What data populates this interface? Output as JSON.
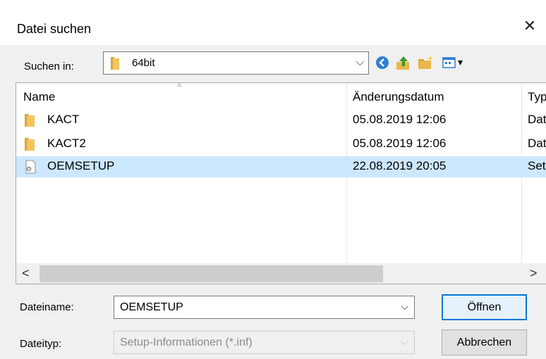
{
  "window": {
    "title": "Datei suchen",
    "close_glyph": "✕"
  },
  "lookin": {
    "label": "Suchen in:",
    "value": "64bit",
    "chevron": "⌵"
  },
  "toolbar": {
    "icons": [
      "back-icon",
      "up-folder-icon",
      "new-folder-icon",
      "view-menu-icon"
    ],
    "view_dropdown_glyph": "▾"
  },
  "list": {
    "columns": [
      {
        "label": "Name"
      },
      {
        "label": "Änderungsdatum"
      },
      {
        "label": "Typ"
      }
    ],
    "sort_glyph": "^",
    "rows": [
      {
        "name": "KACT",
        "date": "05.08.2019 12:06",
        "type": "Dateiordner",
        "icon": "folder-icon"
      },
      {
        "name": "KACT2",
        "date": "05.08.2019 12:06",
        "type": "Dateiordner",
        "icon": "folder-icon"
      },
      {
        "name": "OEMSETUP",
        "date": "22.08.2019 20:05",
        "type": "Setup-Informationen",
        "icon": "setup-file-icon",
        "selected": true
      }
    ],
    "scroll_left": "<",
    "scroll_right": ">"
  },
  "filename": {
    "label": "Dateiname:",
    "value": "OEMSETUP",
    "chevron": "⌵"
  },
  "filetype": {
    "label": "Dateityp:",
    "value": "Setup-Informationen (*.inf)",
    "chevron": "⌵"
  },
  "buttons": {
    "open": "Öffnen",
    "cancel": "Abbrechen"
  },
  "colors": {
    "selection": "#cce8ff",
    "accent": "#0078d7",
    "folder": "#e8b84a"
  }
}
